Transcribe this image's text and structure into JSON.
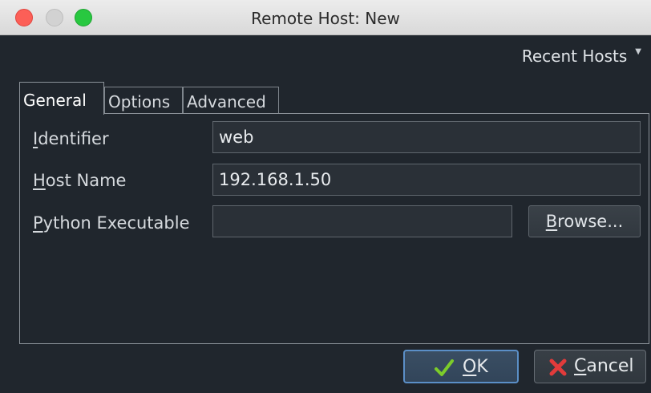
{
  "window": {
    "title": "Remote Host: New"
  },
  "recent_hosts": {
    "label": "Recent Hosts",
    "icon": "chevron-down-icon"
  },
  "tabs": [
    {
      "label": "General",
      "active": true
    },
    {
      "label": "Options",
      "active": false
    },
    {
      "label": "Advanced",
      "active": false
    }
  ],
  "form": {
    "identifier": {
      "label_first": "I",
      "label_rest": "dentifier",
      "value": "web"
    },
    "host_name": {
      "label_first": "H",
      "label_rest": "ost Name",
      "value": "192.168.1.50"
    },
    "python_executable": {
      "label_first": "P",
      "label_rest": "ython Executable",
      "value": ""
    },
    "browse": {
      "label_first": "B",
      "label_rest": "rowse..."
    }
  },
  "buttons": {
    "ok": {
      "label_first": "O",
      "label_rest": "K",
      "icon": "check-icon",
      "color": "#7ccc2a"
    },
    "cancel": {
      "label_first": "C",
      "label_rest": "ancel",
      "icon": "close-icon",
      "color": "#e23b3b"
    }
  },
  "colors": {
    "background": "#20262d",
    "ok_border": "#5b8fc7",
    "traffic_close": "#fc5f57",
    "traffic_min": "#d2d2d2",
    "traffic_max": "#28c840"
  }
}
